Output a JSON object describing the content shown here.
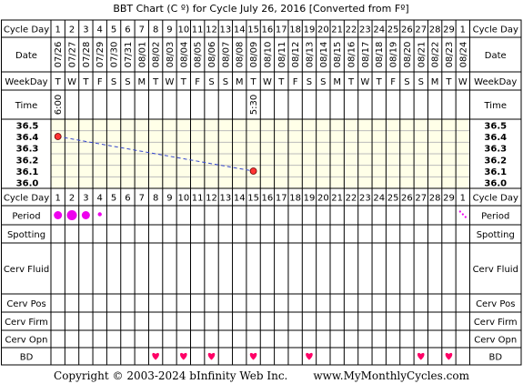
{
  "title": "BBT Chart (C º) for Cycle July 26, 2016  [Converted from Fº]",
  "row_labels": {
    "cycle_day": "Cycle Day",
    "date": "Date",
    "weekday": "WeekDay",
    "time": "Time",
    "period": "Period",
    "spotting": "Spotting",
    "cerv_fluid": "Cerv Fluid",
    "cerv_pos": "Cerv Pos",
    "cerv_firm": "Cerv Firm",
    "cerv_opn": "Cerv Opn",
    "bd": "BD"
  },
  "days": [
    "1",
    "2",
    "3",
    "4",
    "5",
    "6",
    "7",
    "8",
    "9",
    "10",
    "11",
    "12",
    "13",
    "14",
    "15",
    "16",
    "17",
    "18",
    "19",
    "20",
    "21",
    "22",
    "23",
    "24",
    "25",
    "26",
    "27",
    "28",
    "29",
    "1"
  ],
  "dates": [
    "07/26",
    "07/27",
    "07/28",
    "07/29",
    "07/30",
    "07/31",
    "08/01",
    "08/02",
    "08/03",
    "08/04",
    "08/05",
    "08/06",
    "08/07",
    "08/08",
    "08/09",
    "08/10",
    "08/11",
    "08/12",
    "08/13",
    "08/14",
    "08/15",
    "08/16",
    "08/17",
    "08/18",
    "08/19",
    "08/20",
    "08/21",
    "08/22",
    "08/23",
    "08/24"
  ],
  "weekdays": [
    "T",
    "W",
    "T",
    "F",
    "S",
    "S",
    "M",
    "T",
    "W",
    "T",
    "F",
    "S",
    "S",
    "M",
    "T",
    "W",
    "T",
    "F",
    "S",
    "S",
    "M",
    "T",
    "W",
    "T",
    "F",
    "S",
    "S",
    "M",
    "T",
    "W"
  ],
  "times": [
    "6:00",
    "",
    "",
    "",
    "",
    "",
    "",
    "",
    "",
    "",
    "",
    "",
    "",
    "",
    "5:30",
    "",
    "",
    "",
    "",
    "",
    "",
    "",
    "",
    "",
    "",
    "",
    "",
    "",
    "",
    ""
  ],
  "temp_labels": [
    "36.5",
    "36.4",
    "36.3",
    "36.2",
    "36.1",
    "36.0"
  ],
  "period": [
    "heavy",
    "heavy",
    "heavy",
    "light",
    "",
    "",
    "",
    "",
    "",
    "",
    "",
    "",
    "",
    "",
    "",
    "",
    "",
    "",
    "",
    "",
    "",
    "",
    "",
    "",
    "",
    "",
    "",
    "",
    "",
    "spotting-dots"
  ],
  "bd_days": [
    8,
    10,
    12,
    15,
    19,
    27,
    29
  ],
  "colors": {
    "border": "#000000",
    "grid": "#bbbbbb",
    "temp_bg": "#ffffe8",
    "label_bg": "#ffffff",
    "point_fill": "#ff3333",
    "line": "#3344cc",
    "period": "#ee00ee",
    "heart": "#ff0066"
  },
  "chart_data": {
    "type": "line",
    "title": "BBT Chart (C º) for Cycle July 26, 2016  [Converted from Fº]",
    "xlabel": "Cycle Day",
    "ylabel": "",
    "ylim": [
      36.0,
      36.5
    ],
    "x": [
      1,
      15
    ],
    "series": [
      {
        "values": [
          36.4,
          36.1
        ]
      }
    ],
    "line_style": "dashed"
  },
  "footer": {
    "copyright": "Copyright © 2003-2024 bInfinity Web Inc.",
    "site": "www.MyMonthlyCycles.com"
  }
}
